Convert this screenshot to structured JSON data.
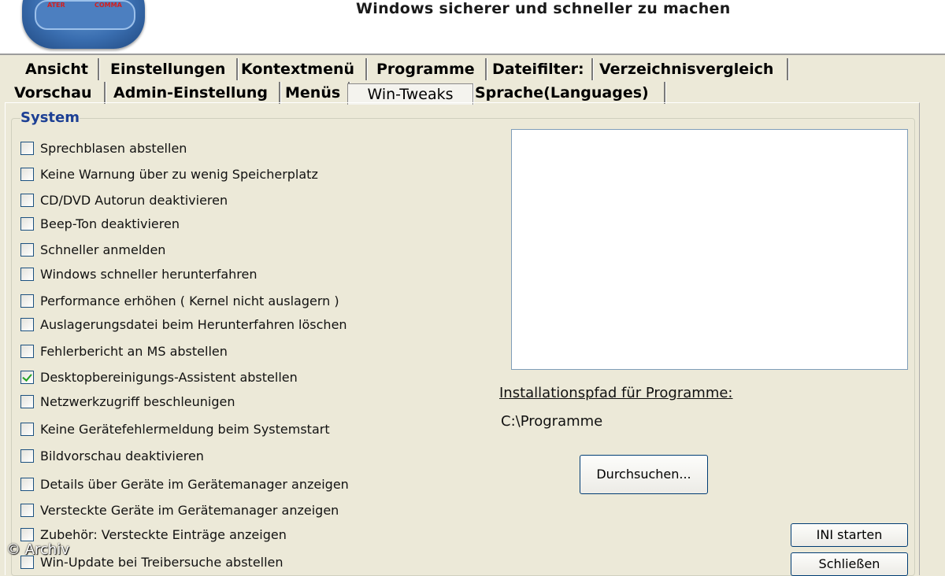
{
  "header": {
    "title": "Windows sicherer und schneller zu machen",
    "logo_text_left": "ATER",
    "logo_text_right": "COMMA"
  },
  "tabs_row1": [
    "Ansicht",
    "Einstellungen",
    "Kontextmenü",
    "Programme",
    "Dateifilter:",
    "Verzeichnisvergleich"
  ],
  "tabs_row2": [
    "Vorschau",
    "Admin-Einstellung",
    "Menüs",
    "Win-Tweaks",
    "Sprache(Languages)"
  ],
  "active_tab": "Win-Tweaks",
  "group": {
    "legend": "System"
  },
  "options": [
    {
      "label": "Sprechblasen abstellen",
      "checked": false
    },
    {
      "label": "Keine Warnung über zu wenig Speicherplatz",
      "checked": false
    },
    {
      "label": "CD/DVD Autorun deaktivieren",
      "checked": false
    },
    {
      "label": "Beep-Ton deaktivieren",
      "checked": false
    },
    {
      "label": "Schneller anmelden",
      "checked": false
    },
    {
      "label": "Windows schneller herunterfahren",
      "checked": false
    },
    {
      "label": "Performance erhöhen ( Kernel nicht auslagern )",
      "checked": false
    },
    {
      "label": "Auslagerungsdatei beim Herunterfahren löschen",
      "checked": false
    },
    {
      "label": "Fehlerbericht an MS abstellen",
      "checked": false
    },
    {
      "label": "Desktopbereinigungs-Assistent abstellen",
      "checked": true
    },
    {
      "label": "Netzwerkzugriff beschleunigen",
      "checked": false
    },
    {
      "label": "Keine Gerätefehlermeldung beim Systemstart",
      "checked": false
    },
    {
      "label": "Bildvorschau deaktivieren",
      "checked": false
    },
    {
      "label": "Details über Geräte im Gerätemanager anzeigen",
      "checked": false
    },
    {
      "label": "Versteckte Geräte im Gerätemanager anzeigen",
      "checked": false
    },
    {
      "label": "Zubehör: Versteckte Einträge anzeigen",
      "checked": false
    },
    {
      "label": "Win-Update bei Treibersuche abstellen",
      "checked": false
    }
  ],
  "install": {
    "label": "Installationspfad für Programme:",
    "path": "C:\\Programme"
  },
  "buttons": {
    "browse": "Durchsuchen...",
    "ini_start": "INI starten",
    "close": "Schließen"
  },
  "watermark": "© Archiv"
}
